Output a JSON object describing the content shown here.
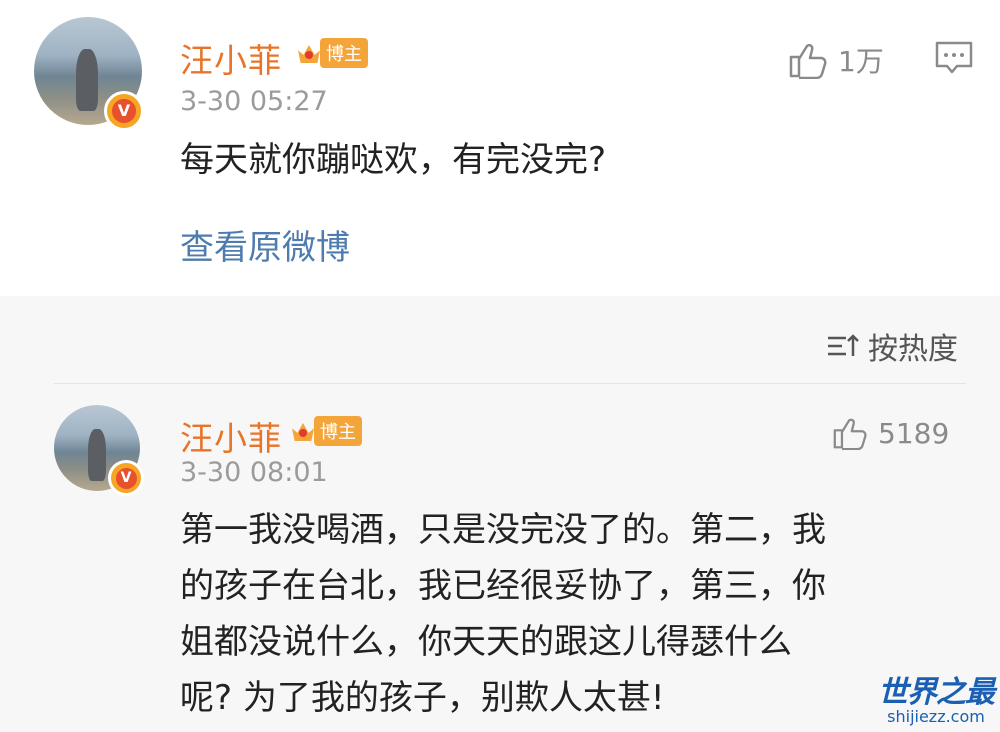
{
  "post": {
    "author": "汪小菲",
    "badge": "博主",
    "time": "3-30 05:27",
    "content": "每天就你蹦哒欢，有完没完?",
    "view_original": "查看原微博",
    "likes": "1万"
  },
  "sort": {
    "label": "按热度"
  },
  "reply": {
    "author": "汪小菲",
    "badge": "博主",
    "time": "3-30 08:01",
    "lines": [
      "第一我没喝酒，只是没完没了的。第二，我",
      "的孩子在台北，我已经很妥协了，第三，你",
      "姐都没说什么，你天天的跟这儿得瑟什么",
      "呢? 为了我的孩子，别欺人太甚!"
    ],
    "likes": "5189"
  },
  "watermark": {
    "title": "世界之最",
    "url": "shijiezz.com"
  },
  "colors": {
    "name": "#e8742a",
    "link": "#4f7cae",
    "badge": "#f3a53a",
    "time": "#9b9b9b"
  }
}
